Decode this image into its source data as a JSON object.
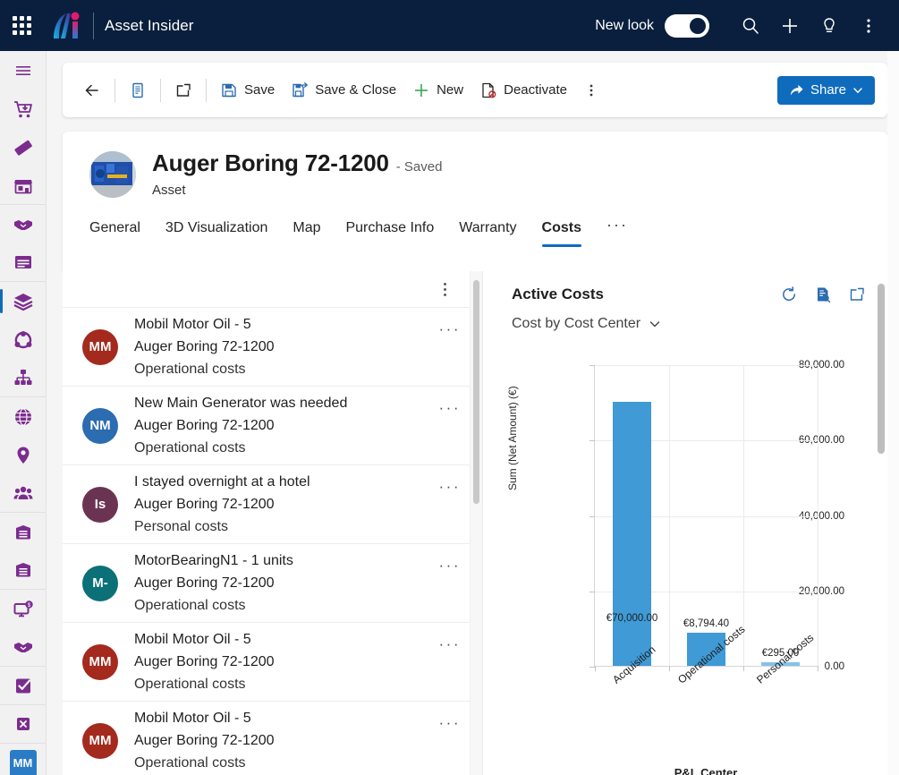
{
  "topnav": {
    "waffle_label": "app-launcher",
    "brand": "Asset Insider",
    "new_look_label": "New look",
    "new_look_on": true,
    "icons": [
      "search-icon",
      "plus-icon",
      "lightbulb-icon",
      "more-vertical-icon"
    ],
    "background": "#091f3d"
  },
  "rail": {
    "items": [
      {
        "name": "hamburger-menu",
        "icon": "hamburger-icon",
        "active": false,
        "group_end": false
      },
      {
        "name": "purchase-orders",
        "icon": "shopping-cart-down-icon",
        "active": false,
        "group_end": false
      },
      {
        "name": "tickets",
        "icon": "ticket-icon",
        "active": false,
        "group_end": false
      },
      {
        "name": "storefront",
        "icon": "storefront-icon",
        "active": false,
        "group_end": true
      },
      {
        "name": "partners",
        "icon": "handshake-icon",
        "active": false,
        "group_end": false
      },
      {
        "name": "articles",
        "icon": "article-icon",
        "active": false,
        "group_end": true
      },
      {
        "name": "assets",
        "icon": "layers-icon",
        "active": true,
        "group_end": false
      },
      {
        "name": "components",
        "icon": "node-network-icon",
        "active": false,
        "group_end": false
      },
      {
        "name": "hierarchy",
        "icon": "org-chart-icon",
        "active": false,
        "group_end": true
      },
      {
        "name": "global",
        "icon": "globe-icon",
        "active": false,
        "group_end": false
      },
      {
        "name": "locations",
        "icon": "map-pin-icon",
        "active": false,
        "group_end": false
      },
      {
        "name": "contacts",
        "icon": "people-icon",
        "active": false,
        "group_end": true
      },
      {
        "name": "inventory",
        "icon": "box-icon",
        "active": false,
        "group_end": false
      },
      {
        "name": "archive",
        "icon": "box-icon",
        "active": false,
        "group_end": true
      },
      {
        "name": "billing",
        "icon": "monitor-dollar-icon",
        "active": false,
        "group_end": false,
        "badge": "$"
      },
      {
        "name": "agreements",
        "icon": "handshake-icon",
        "active": false,
        "group_end": true
      },
      {
        "name": "tasks",
        "icon": "checkbox-check-icon",
        "active": false,
        "group_end": true
      },
      {
        "name": "close",
        "icon": "close-square-icon",
        "active": false,
        "group_end": true
      }
    ],
    "avatar_initials": "MM"
  },
  "commandbar": {
    "back_label": "back-arrow",
    "buttons": [
      {
        "name": "save-button",
        "label": "Save",
        "icon": "save-icon"
      },
      {
        "name": "save-close-button",
        "label": "Save & Close",
        "icon": "save-close-icon"
      },
      {
        "name": "new-button",
        "label": "New",
        "icon": "plus-icon"
      },
      {
        "name": "deactivate-button",
        "label": "Deactivate",
        "icon": "deactivate-icon"
      }
    ],
    "overflow_label": "more-commands",
    "share_label": "Share",
    "share_color": "#0f6cbd"
  },
  "record": {
    "title": "Auger Boring 72-1200",
    "state": "- Saved",
    "entity": "Asset",
    "thumbnail_alt": "asset-photo"
  },
  "tabs": {
    "items": [
      {
        "label": "General",
        "active": false
      },
      {
        "label": "3D Visualization",
        "active": false
      },
      {
        "label": "Map",
        "active": false
      },
      {
        "label": "Purchase Info",
        "active": false
      },
      {
        "label": "Warranty",
        "active": false
      },
      {
        "label": "Costs",
        "active": true
      }
    ],
    "overflow": "···"
  },
  "cost_list": {
    "rows": [
      {
        "initials": "MM",
        "color": "#a42a1e",
        "title": "Mobil Motor Oil - 5",
        "asset": "Auger Boring 72-1200",
        "category": "Operational costs"
      },
      {
        "initials": "NM",
        "color": "#2c6cb0",
        "title": "New Main Generator was needed",
        "asset": "Auger Boring 72-1200",
        "category": "Operational costs"
      },
      {
        "initials": "Is",
        "color": "#6b3352",
        "title": "I stayed overnight at a hotel",
        "asset": "Auger Boring 72-1200",
        "category": "Personal costs"
      },
      {
        "initials": "M-",
        "color": "#0b7078",
        "title": "MotorBearingN1 - 1 units",
        "asset": "Auger Boring 72-1200",
        "category": "Operational costs"
      },
      {
        "initials": "MM",
        "color": "#a42a1e",
        "title": "Mobil Motor Oil - 5",
        "asset": "Auger Boring 72-1200",
        "category": "Operational costs"
      },
      {
        "initials": "MM",
        "color": "#a42a1e",
        "title": "Mobil Motor Oil - 5",
        "asset": "Auger Boring 72-1200",
        "category": "Operational costs"
      }
    ],
    "row_overflow": "···"
  },
  "chart_panel": {
    "title": "Active Costs",
    "refresh_label": "refresh-icon",
    "report_label": "view-records-icon",
    "popout_label": "popout-icon",
    "view_selector": "Cost by Cost Center"
  },
  "chart_data": {
    "type": "bar",
    "title": "Cost by Cost Center",
    "categories": [
      "Acquisition",
      "Operational costs",
      "Personal costs"
    ],
    "values": [
      70000.0,
      8794.4,
      295.0
    ],
    "value_labels": [
      "€70,000.00",
      "€8,794.40",
      "€295.00"
    ],
    "xlabel": "P&L Center",
    "ylabel": "Sum (Net Amount) (€)",
    "ylim": [
      0,
      80000
    ],
    "yticks": [
      0,
      20000,
      40000,
      60000,
      80000
    ],
    "ytick_labels": [
      "0.00",
      "20,000.00",
      "40,000.00",
      "60,000.00",
      "80,000.00"
    ],
    "grid": true,
    "legend": false,
    "bar_color": "#3f9ad6"
  }
}
